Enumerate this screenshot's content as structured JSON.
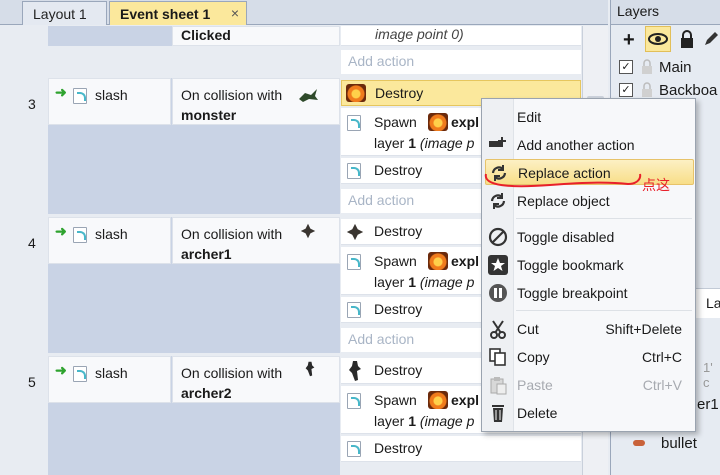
{
  "tabs": {
    "layout": "Layout 1",
    "event_sheet": "Event sheet 1",
    "close_glyph": "×"
  },
  "events": {
    "top": {
      "condition_text": "Clicked",
      "action_text": "image point 0)",
      "add_action": "Add action"
    },
    "e3": {
      "number": "3",
      "object": "slash",
      "condition": "On collision with",
      "target": "monster",
      "a1": "Destroy",
      "a2_verb": "Spawn",
      "a2_obj": "expl",
      "a2_layer_prefix": "layer ",
      "a2_layer": "1",
      "a2_suffix": " (image p",
      "a3": "Destroy",
      "add_action": "Add action"
    },
    "e4": {
      "number": "4",
      "object": "slash",
      "condition": "On collision with",
      "target": "archer1",
      "a1": "Destroy",
      "a2_verb": "Spawn",
      "a2_obj": "expl",
      "a2_layer_prefix": "layer ",
      "a2_layer": "1",
      "a2_suffix": " (image p",
      "a3": "Destroy",
      "add_action": "Add action"
    },
    "e5": {
      "number": "5",
      "object": "slash",
      "condition": "On collision with",
      "target": "archer2",
      "a1": "Destroy",
      "a2_verb": "Spawn",
      "a2_obj": "expl",
      "a2_layer_prefix": "layer ",
      "a2_layer": "1",
      "a2_suffix": " (image p",
      "a3": "Destroy"
    }
  },
  "layers_panel": {
    "title": "Layers",
    "items": [
      "Main",
      "Backboa"
    ],
    "partial_text": "La",
    "lower_partial_1": "1' c",
    "lower_partial_2": "er1",
    "bullet": "bullet"
  },
  "context_menu": {
    "items": [
      {
        "label": "Edit",
        "shortcut": ""
      },
      {
        "label": "Add another action",
        "shortcut": ""
      },
      {
        "label": "Replace action",
        "shortcut": ""
      },
      {
        "label": "Replace object",
        "shortcut": ""
      },
      {
        "label": "Toggle disabled",
        "shortcut": ""
      },
      {
        "label": "Toggle bookmark",
        "shortcut": ""
      },
      {
        "label": "Toggle breakpoint",
        "shortcut": ""
      },
      {
        "label": "Cut",
        "shortcut": "Shift+Delete"
      },
      {
        "label": "Copy",
        "shortcut": "Ctrl+C"
      },
      {
        "label": "Paste",
        "shortcut": "Ctrl+V"
      },
      {
        "label": "Delete",
        "shortcut": ""
      }
    ]
  },
  "annotation": {
    "text": "点这",
    "color": "#e8202a"
  },
  "colors": {
    "selection": "#fbe89c",
    "block": "#c9d3e5",
    "accent_green": "#2fa32f"
  }
}
